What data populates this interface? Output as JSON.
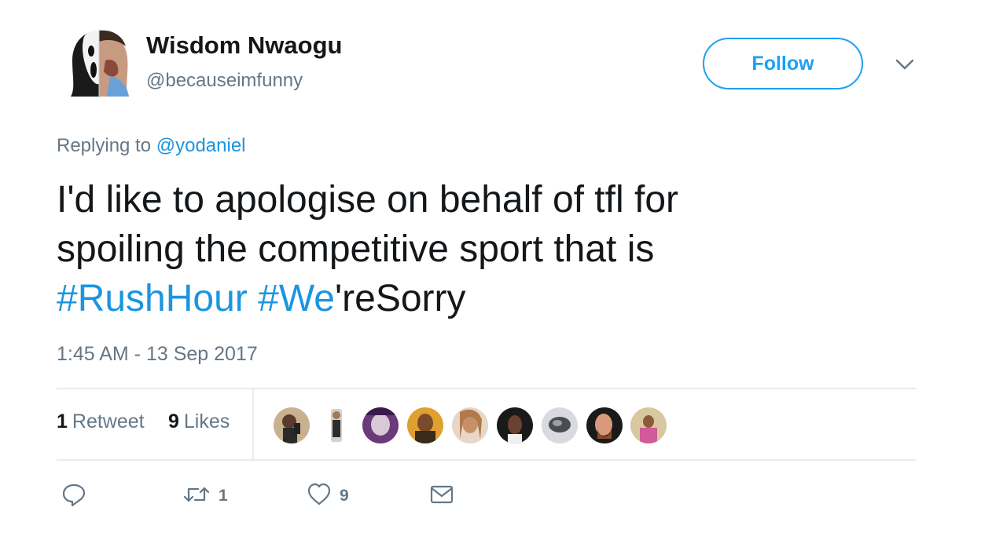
{
  "user": {
    "display_name": "Wisdom Nwaogu",
    "handle": "@becauseimfunny"
  },
  "header": {
    "follow_label": "Follow"
  },
  "reply": {
    "prefix": "Replying to ",
    "mention": "@yodaniel"
  },
  "tweet": {
    "text_line1": "I'd like to apologise on behalf of tfl for",
    "text_line2": "spoiling the competitive sport that is",
    "hashtag1": "#RushHour",
    "hashtag2_part": "#We",
    "hashtag2_rest": "'reSorry",
    "timestamp": "1:45 AM - 13 Sep 2017"
  },
  "stats": {
    "retweets_count": "1",
    "retweets_label": "Retweet",
    "likes_count": "9",
    "likes_label": "Likes"
  },
  "actions": {
    "retweet_count": "1",
    "like_count": "9"
  },
  "colors": {
    "accent": "#1da1f2",
    "hashtag": "#1b95e0",
    "muted": "#657786",
    "text": "#14171a",
    "divider": "#e6ecf0"
  },
  "icons": {
    "reply": "reply-icon",
    "retweet": "retweet-icon",
    "like": "heart-icon",
    "message": "envelope-icon",
    "menu": "chevron-down-icon"
  }
}
